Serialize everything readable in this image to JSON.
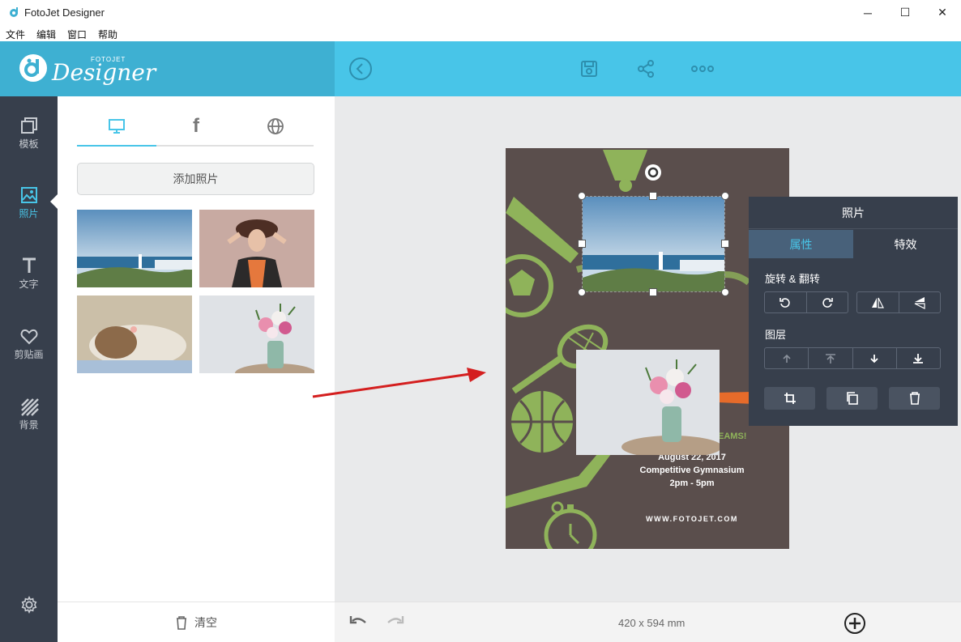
{
  "window": {
    "title": "FotoJet Designer",
    "minimize": "─",
    "maximize": "☐",
    "close": "✕"
  },
  "menu": [
    "文件",
    "编辑",
    "窗口",
    "帮助"
  ],
  "brand": {
    "logo_small": "FOTOJET",
    "logo_main": "Designer"
  },
  "toolbar": {
    "icons": [
      "back-icon",
      "save-icon",
      "share-icon",
      "more-icon"
    ]
  },
  "sidebar": {
    "items": [
      {
        "label": "模板",
        "icon": "template-icon"
      },
      {
        "label": "照片",
        "icon": "photo-icon"
      },
      {
        "label": "文字",
        "icon": "text-icon"
      },
      {
        "label": "剪贴画",
        "icon": "clipart-icon"
      },
      {
        "label": "背景",
        "icon": "background-icon"
      }
    ],
    "settings_icon": "gear-icon"
  },
  "panel": {
    "tabs": [
      "computer-icon",
      "facebook-icon",
      "globe-icon"
    ],
    "add_photo": "添加照片",
    "clear": "清空"
  },
  "poster": {
    "headline_fragment": "EAMS!",
    "date": "August 22, 2017",
    "venue": "Competitive Gymnasium",
    "time": "2pm - 5pm",
    "website": "WWW.FOTOJET.COM"
  },
  "properties": {
    "title": "照片",
    "tab_properties": "属性",
    "tab_effects": "特效",
    "rotate_flip": "旋转 & 翻转",
    "layer": "图层"
  },
  "bottombar": {
    "size": "420 x 594 mm"
  },
  "colors": {
    "accent": "#48c5e8",
    "sidebar": "#373f4c",
    "poster_bg": "#5a4e4c",
    "poster_green": "#8fb35a"
  }
}
